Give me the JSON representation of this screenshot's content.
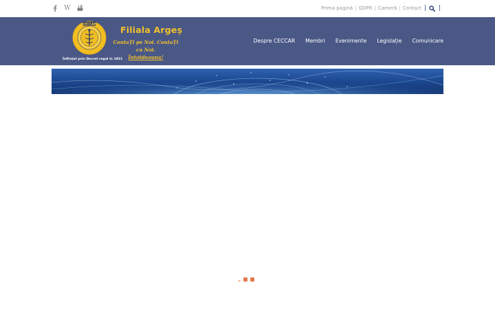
{
  "social": {
    "icons": [
      "facebook-icon",
      "wikipedia-icon",
      "youtube-icon"
    ],
    "wikipedia_glyph": "W"
  },
  "top_links": [
    "Prima pagină",
    "GDPR",
    "Cameră",
    "Contact"
  ],
  "top_separator": "|",
  "brand": {
    "name": "Filiala Argeș",
    "slogan_line1": "ContaȚi pe Noi. ContaȚi cu Noi.",
    "slogan_line2": "Întotdeauna!",
    "seal_text": "CECCAR",
    "founded_note": "Înființat prin Decret regal în 1921"
  },
  "nav": [
    "Despre CECCAR",
    "Membri",
    "Evenimente",
    "Legislație",
    "Comunicare"
  ],
  "colors": {
    "header_bg": "#4a5886",
    "brand_gold": "#f3c12b",
    "loader": "#e07a4f"
  }
}
